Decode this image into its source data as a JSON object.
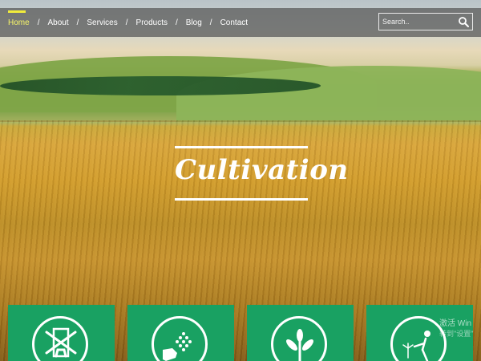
{
  "nav": {
    "items": [
      {
        "label": "Home",
        "active": true
      },
      {
        "label": "About",
        "active": false
      },
      {
        "label": "Services",
        "active": false
      },
      {
        "label": "Products",
        "active": false
      },
      {
        "label": "Blog",
        "active": false
      },
      {
        "label": "Contact",
        "active": false
      }
    ],
    "separator": "/",
    "active_color": "#f1ec3b"
  },
  "search": {
    "placeholder": "Search..",
    "icon": "search-icon"
  },
  "hero": {
    "title": "Cultivation"
  },
  "cards": [
    {
      "icon": "windmill-icon"
    },
    {
      "icon": "seed-sowing-icon"
    },
    {
      "icon": "sprout-icon"
    },
    {
      "icon": "harvest-icon"
    }
  ],
  "card_color": "#19a162",
  "watermark": {
    "line1": "激活 Win",
    "line2": "转到\"设置\""
  }
}
